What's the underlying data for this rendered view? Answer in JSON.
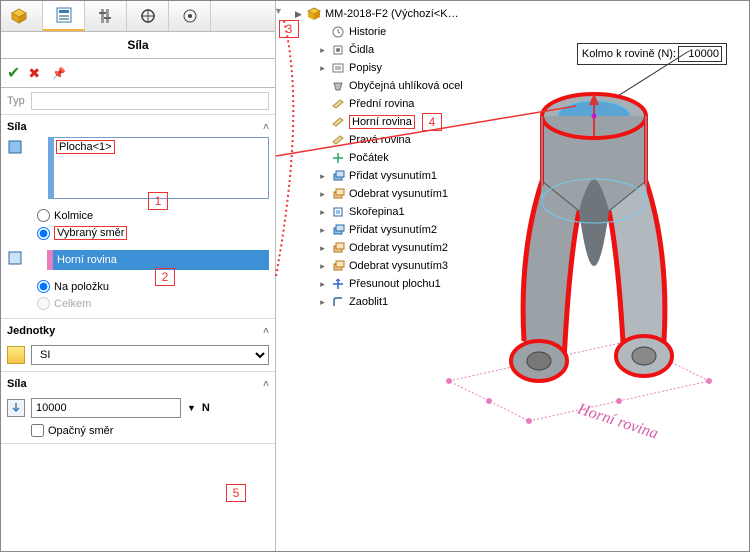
{
  "panel": {
    "title": "Síla",
    "typ_label": "Typ",
    "section_sila": "Síla",
    "face_selected": "Plocha<1>",
    "radio_kolmice": "Kolmice",
    "radio_smer": "Vybraný směr",
    "direction_selected": "Horní rovina",
    "radio_polozka": "Na položku",
    "radio_celkem": "Celkem",
    "section_units": "Jednotky",
    "units_value": "SI",
    "section_force": "Síla",
    "force_value": "10000",
    "force_unit": "N",
    "reverse_label": "Opačný směr"
  },
  "callouts": {
    "c1": "1",
    "c2": "2",
    "c3": "3",
    "c4": "4",
    "c5": "5"
  },
  "doc_title": "MM-2018-F2  (Výchozí<K…",
  "tree": [
    {
      "label": "Historie",
      "icon": "history"
    },
    {
      "label": "Čidla",
      "icon": "sensor"
    },
    {
      "label": "Popisy",
      "icon": "annot"
    },
    {
      "label": "Obyčejná uhlíková ocel",
      "icon": "material"
    },
    {
      "label": "Přední rovina",
      "icon": "plane"
    },
    {
      "label": "Horní rovina",
      "icon": "plane",
      "highlight": true
    },
    {
      "label": "Pravá rovina",
      "icon": "plane"
    },
    {
      "label": "Počátek",
      "icon": "origin"
    },
    {
      "label": "Přidat vysunutím1",
      "icon": "extrude"
    },
    {
      "label": "Odebrat vysunutím1",
      "icon": "cut"
    },
    {
      "label": "Skořepina1",
      "icon": "shell"
    },
    {
      "label": "Přidat vysunutím2",
      "icon": "extrude"
    },
    {
      "label": "Odebrat vysunutím2",
      "icon": "cut"
    },
    {
      "label": "Odebrat vysunutím3",
      "icon": "cut"
    },
    {
      "label": "Přesunout plochu1",
      "icon": "move"
    },
    {
      "label": "Zaoblit1",
      "icon": "fillet"
    }
  ],
  "tooltip": {
    "label": "Kolmo k rovině (N):",
    "value": "10000"
  },
  "plane_label_3d": "Horní rovina"
}
